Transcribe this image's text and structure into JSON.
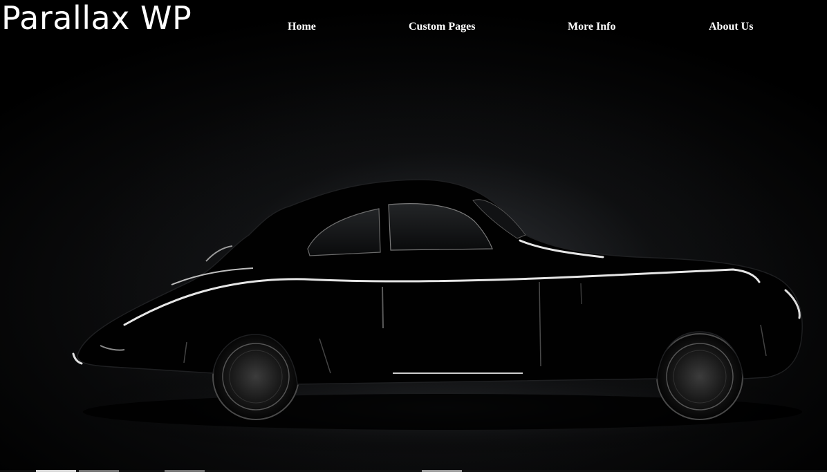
{
  "header": {
    "site_title": "Parallax WP"
  },
  "nav": {
    "items": [
      {
        "label": "Home"
      },
      {
        "label": "Custom Pages"
      },
      {
        "label": "More Info"
      },
      {
        "label": "About Us"
      }
    ]
  },
  "hero": {
    "image": "black-vintage-coupe-silhouette",
    "background_color": "#000000"
  },
  "colors": {
    "text": "#ffffff",
    "background": "#000000",
    "highlight": "#e6e6e6"
  }
}
